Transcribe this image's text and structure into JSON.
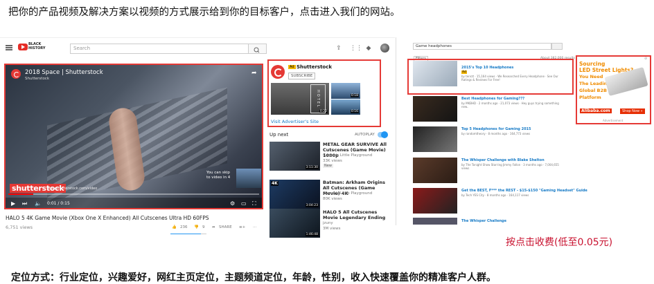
{
  "captions": {
    "top": "把你的产品视频及解决方案以视频的方式展示给到你的目标客户，点击进入我们的网站。",
    "price": "按点击收费(低至0.05元)",
    "bottom": "定位方式：行业定位，兴趣爱好，网红主页定位，主题频道定位，年龄，性别，收入快速覆盖你的精准客户人群。"
  },
  "youtube": {
    "logo_text_1": "BLACK",
    "logo_text_2": "HISTORY",
    "search_placeholder": "Search",
    "player": {
      "title": "2018 Space | Shutterstock",
      "channel": "Shutterstock",
      "watermark": "shutterstock",
      "watermark_url": "www.shutterstock.com/video",
      "skip_text": "You can skip to video in 4",
      "time": "0:01 / 0:15",
      "progress": 0.1
    },
    "video_title": "HALO 5 4K Game Movie (Xbox One X Enhanced) All Cutscenes Ultra HD 60FPS",
    "views": "6,751 views",
    "likes": "236",
    "dislikes": "9",
    "share": "SHARE",
    "ad_card": {
      "badge": "Ad",
      "name": "Shutterstock",
      "subscribe": "SUBSCRIBE",
      "thumb_text": "HOTEL",
      "dur1": "0:20",
      "dur2": "0:18",
      "dur3": "0:16",
      "visit": "Visit Advertiser's Site"
    },
    "up_next": "Up next",
    "autoplay": "AUTOPLAY",
    "videos": [
      {
        "title": "METAL GEAR SURVIVE All Cutscenes (Game Movie) 1080p",
        "channel": "Gamer's Little Playground",
        "views": "33K views",
        "badge": "New",
        "duration": "3:11:30"
      },
      {
        "title": "Batman: Arkham Origins All Cutscenes (Game Movie) 4K",
        "channel": "Gamer's Little Playground",
        "views": "80K views",
        "badge": "4K",
        "duration": "3:04:23"
      },
      {
        "title": "HALO 5 All Cutscenes Movie Legendary Ending",
        "channel": "jzuny",
        "views": "3M views",
        "badge": "",
        "duration": "1:46:48"
      }
    ]
  },
  "google_ads": {
    "search_query": "Game headphones",
    "filters": "Filters",
    "results": "About 382,000 results",
    "ad_result": {
      "title": "2015's Top 10 Headphones",
      "meta": "by tenrzt · 15,164 views · We Researched Every Headphone · See Our Ratings & Reviews For Free!",
      "badge": "Ad"
    },
    "results_list": [
      {
        "title": "Best Headphones for Gaming???",
        "meta": "by MKBHD · 2 months ago · 21,073 views · Hey guys trying something new.."
      },
      {
        "title": "Top 5 Headphones for Gaming 2015",
        "meta": "by randomtheory · 8 months ago · 164,773 views"
      },
      {
        "title": "The Whisper Challenge with Blake Shelton",
        "meta": "by The Tonight Show Starring Jimmy Fallon · 3 months ago · 7,004,655 views"
      },
      {
        "title": "Get the BEST, F*** the REST - $15-$150 \"Gaming Headset\" Guide",
        "meta": "by Tech YES City · 8 months ago · 164,117 views"
      },
      {
        "title": "The Whisper Challenge",
        "meta": ""
      }
    ],
    "sidebar_ad": {
      "line1": "Sourcing",
      "line2": "LED Street Lights?",
      "line3": "You Need",
      "line4": "The Leading",
      "line5": "Global B2B",
      "line6": "Platform",
      "brand": "Alibaba.com",
      "cta": "Shop Now »",
      "label": "Advertisement"
    }
  }
}
